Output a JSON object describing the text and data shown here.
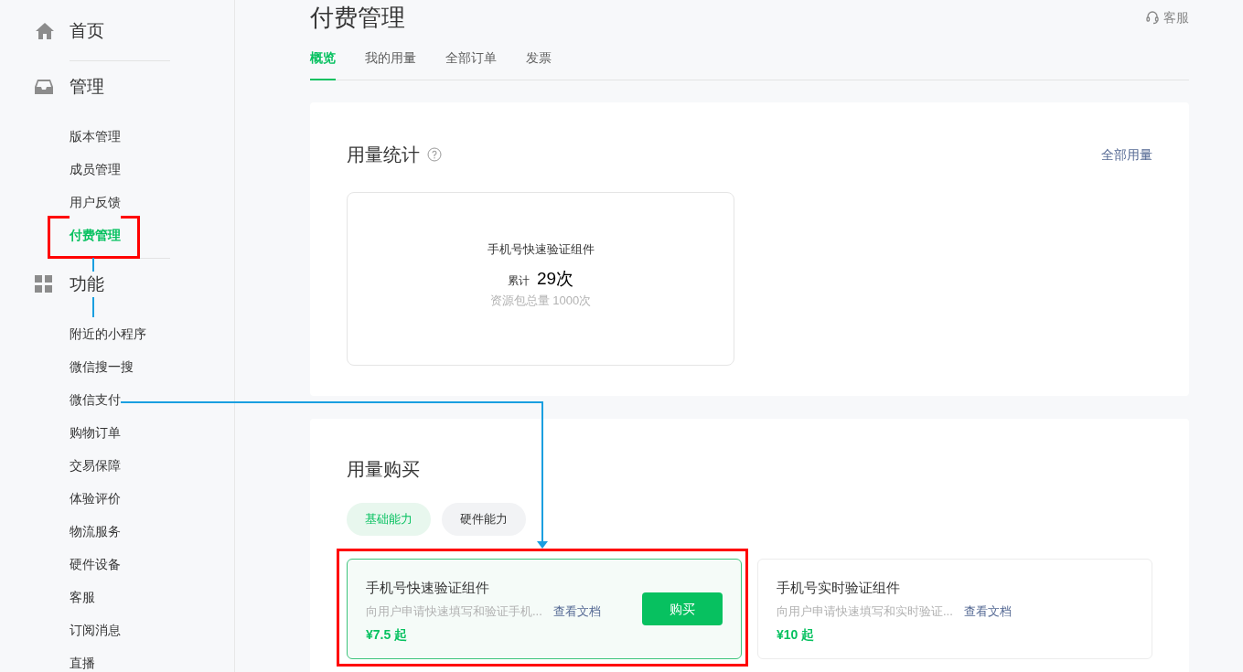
{
  "sidebar": {
    "sections": [
      {
        "label": "首页"
      },
      {
        "label": "管理",
        "items": [
          {
            "label": "版本管理",
            "selected": false
          },
          {
            "label": "成员管理",
            "selected": false
          },
          {
            "label": "用户反馈",
            "selected": false
          },
          {
            "label": "付费管理",
            "selected": true
          }
        ]
      },
      {
        "label": "功能",
        "items": [
          {
            "label": "附近的小程序",
            "selected": false
          },
          {
            "label": "微信搜一搜",
            "selected": false
          },
          {
            "label": "微信支付",
            "selected": false
          },
          {
            "label": "购物订单",
            "selected": false
          },
          {
            "label": "交易保障",
            "selected": false
          },
          {
            "label": "体验评价",
            "selected": false
          },
          {
            "label": "物流服务",
            "selected": false
          },
          {
            "label": "硬件设备",
            "selected": false
          },
          {
            "label": "客服",
            "selected": false
          },
          {
            "label": "订阅消息",
            "selected": false
          },
          {
            "label": "直播",
            "selected": false
          }
        ]
      }
    ]
  },
  "page": {
    "title": "付费管理",
    "support": "客服"
  },
  "tabs": [
    {
      "label": "概览",
      "selected": true
    },
    {
      "label": "我的用量",
      "selected": false
    },
    {
      "label": "全部订单",
      "selected": false
    },
    {
      "label": "发票",
      "selected": false
    }
  ],
  "usage_stats": {
    "title": "用量统计",
    "link": "全部用量",
    "card": {
      "name": "手机号快速验证组件",
      "total_label": "累计",
      "total": "29次",
      "quota": "资源包总量 1000次"
    }
  },
  "purchase": {
    "title": "用量购买",
    "filters": [
      {
        "label": "基础能力",
        "selected": true
      },
      {
        "label": "硬件能力",
        "selected": false
      }
    ],
    "products": [
      {
        "name": "手机号快速验证组件",
        "description": "向用户申请快速填写和验证手机...",
        "doc_link": "查看文档",
        "price": "¥7.5 起",
        "selected": true,
        "button": "购买"
      },
      {
        "name": "手机号实时验证组件",
        "description": "向用户申请快速填写和实时验证...",
        "doc_link": "查看文档",
        "price": "¥10 起",
        "selected": false
      }
    ]
  }
}
